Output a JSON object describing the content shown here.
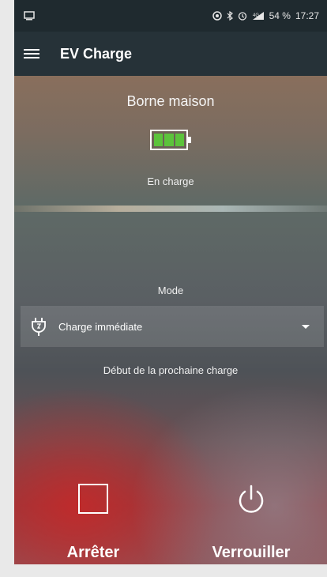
{
  "status_bar": {
    "battery_percent": "54 %",
    "time": "17:27",
    "icons": [
      "screenshot-icon",
      "location-icon",
      "bluetooth-icon",
      "alarm-icon",
      "signal-icon"
    ]
  },
  "app_bar": {
    "title": "EV Charge",
    "menu_icon": "hamburger-menu-icon"
  },
  "station": {
    "name": "Borne maison",
    "battery_icon": "battery-charging-icon",
    "battery_level": 1.0,
    "status": "En charge"
  },
  "mode": {
    "label": "Mode",
    "selected": "Charge immédiate",
    "icon": "plug-icon"
  },
  "next_charge": {
    "label": "Début de la prochaine charge"
  },
  "actions": {
    "stop_label": "Arrêter",
    "lock_label": "Verrouiller"
  },
  "colors": {
    "appbar": "#263238",
    "statusbar": "#1f2a2f",
    "battery_fill": "#5cc33c",
    "text": "#ffffff"
  }
}
